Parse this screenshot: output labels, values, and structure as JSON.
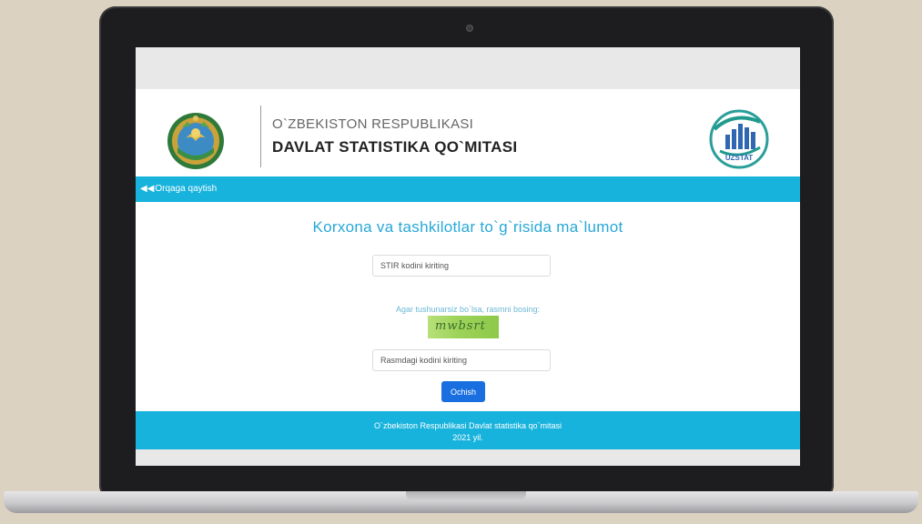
{
  "header": {
    "org_line1": "O`ZBEKISTON RESPUBLIKASI",
    "org_line2": "DAVLAT STATISTIKA QO`MITASI",
    "logo_label": "UZSTAT"
  },
  "nav": {
    "back_label": "Orqaga qaytish",
    "back_icon": "double-left-arrow-icon"
  },
  "form": {
    "title": "Korxona va tashkilotlar to`g`risida ma`lumot",
    "stir_placeholder": "STIR kodini kiriting",
    "captcha_hint": "Agar tushunarsiz bo`lsa, rasmni bosing:",
    "captcha_text": "mwbsrt",
    "code_placeholder": "Rasmdagi kodini kiriting",
    "submit_label": "Ochish"
  },
  "footer": {
    "line1": "O`zbekiston Respublikasi Davlat statistika qo`mitasi",
    "line2": "2021 yil."
  },
  "colors": {
    "accent": "#17b3dd",
    "title": "#28a8d8",
    "button": "#1a6fe0"
  }
}
